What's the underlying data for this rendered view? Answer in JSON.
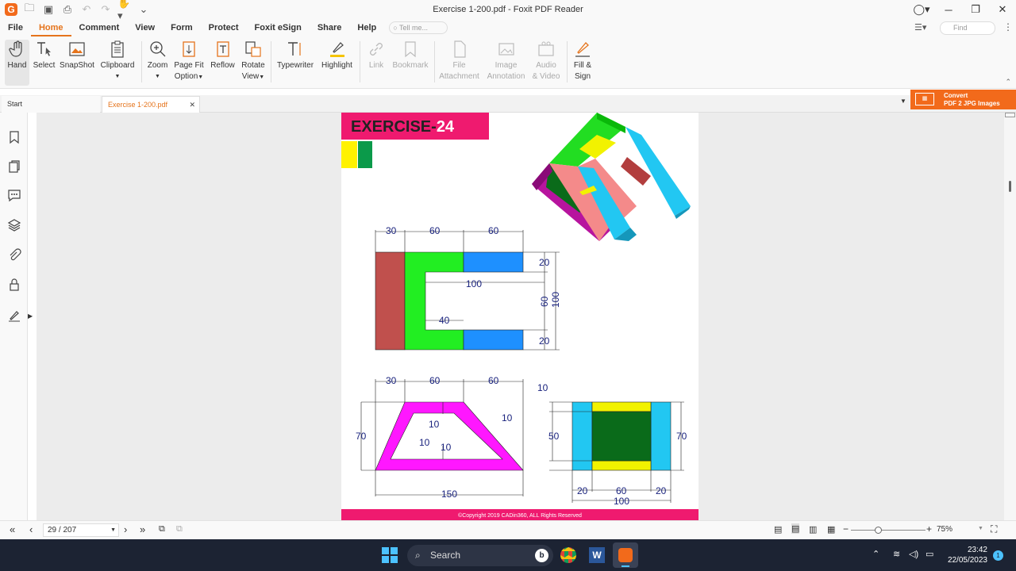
{
  "window": {
    "title": "Exercise 1-200.pdf - Foxit PDF Reader"
  },
  "menubar": {
    "items": [
      "File",
      "Home",
      "Comment",
      "View",
      "Form",
      "Protect",
      "Foxit eSign",
      "Share",
      "Help"
    ],
    "tell_me_placeholder": "Tell me...",
    "find_placeholder": "Find"
  },
  "ribbon": {
    "hand": "Hand",
    "select": "Select",
    "snapshot": "SnapShot",
    "clipboard": "Clipboard",
    "zoom": "Zoom",
    "pagefit1": "Page Fit",
    "pagefit2": "Option",
    "reflow": "Reflow",
    "rotate1": "Rotate",
    "rotate2": "View",
    "typewriter": "Typewriter",
    "highlight": "Highlight",
    "link": "Link",
    "bookmark": "Bookmark",
    "fileatt1": "File",
    "fileatt2": "Attachment",
    "imgann1": "Image",
    "imgann2": "Annotation",
    "audio1": "Audio",
    "audio2": "& Video",
    "fill1": "Fill &",
    "fill2": "Sign"
  },
  "tabs": {
    "start": "Start",
    "doc": "Exercise 1-200.pdf"
  },
  "convert": {
    "line1": "Convert",
    "line2": "PDF 2 JPG Images"
  },
  "document": {
    "heading_word": "EXERCISE-",
    "heading_number": "24",
    "copyright": "©Copyright 2019 CADin360, ALL Rights Reserved",
    "dims": {
      "top_30": "30",
      "top_60a": "60",
      "top_60b": "60",
      "r20a": "20",
      "r20b": "20",
      "r60": "60",
      "r100": "100",
      "in100": "100",
      "in40": "40",
      "t30": "30",
      "t60a": "60",
      "t60b": "60",
      "t70": "70",
      "t10a": "10",
      "t10b": "10",
      "t10c": "10",
      "t10d": "10",
      "t150": "150",
      "s10": "10",
      "s50": "50",
      "s70": "70",
      "s20a": "20",
      "s60": "60",
      "s20b": "20",
      "s100": "100"
    }
  },
  "status": {
    "page": "29 / 207",
    "zoom": "75%"
  },
  "taskbar": {
    "search": "Search",
    "time": "23:42",
    "date": "22/05/2023",
    "badge": "1"
  }
}
